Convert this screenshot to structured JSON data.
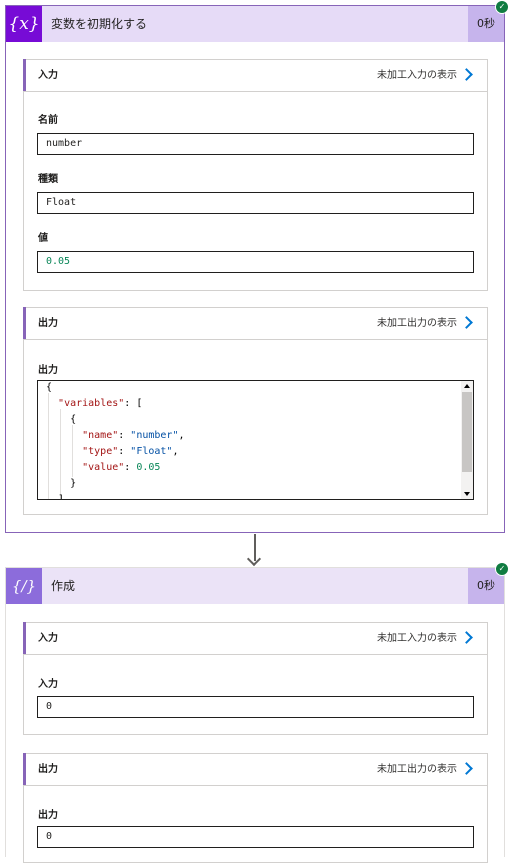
{
  "actions": [
    {
      "title": "変数を初期化する",
      "icon": "variable-icon",
      "icon_text": "{x}",
      "duration": "0秒",
      "inputs": {
        "header": "入力",
        "raw_link": "未加工入力の表示",
        "fields": [
          {
            "label": "名前",
            "value": "number"
          },
          {
            "label": "種類",
            "value": "Float"
          },
          {
            "label": "値",
            "value": "0.05"
          }
        ]
      },
      "outputs": {
        "header": "出力",
        "raw_link": "未加工出力の表示",
        "label": "出力",
        "code": {
          "open_brace": "{",
          "variables_key": "\"variables\"",
          "open_bracket": "[",
          "item_open": "{",
          "name_key": "\"name\"",
          "name_value": "\"number\"",
          "type_key": "\"type\"",
          "type_value": "\"Float\"",
          "value_key": "\"value\"",
          "value_value": "0.05",
          "item_close": "}",
          "close_bracket": "]"
        }
      }
    },
    {
      "title": "作成",
      "icon": "compose-icon",
      "icon_text": "{/}",
      "duration": "0秒",
      "inputs": {
        "header": "入力",
        "raw_link": "未加工入力の表示",
        "label": "入力",
        "value": "0"
      },
      "outputs": {
        "header": "出力",
        "raw_link": "未加工出力の表示",
        "label": "出力",
        "value": "0"
      }
    }
  ],
  "colors": {
    "variable_accent": "#770bd6",
    "compose_accent": "#8c6cdb",
    "success": "#107c41",
    "link": "#0078d4"
  }
}
